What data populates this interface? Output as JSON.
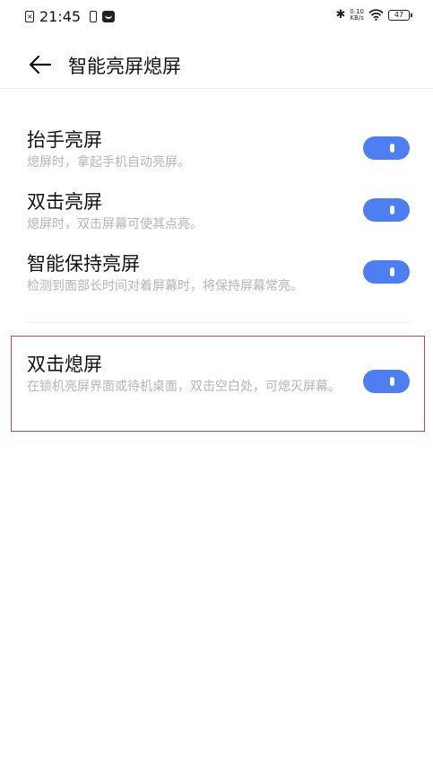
{
  "status_bar": {
    "time": "21:45",
    "net_speed_value": "0.10",
    "net_speed_unit": "KB/s",
    "battery_level": "47"
  },
  "header": {
    "title": "智能亮屏熄屏"
  },
  "settings": [
    {
      "title": "抬手亮屏",
      "description": "熄屏时，拿起手机自动亮屏。",
      "enabled": true
    },
    {
      "title": "双击亮屏",
      "description": "熄屏时，双击屏幕可使其点亮。",
      "enabled": true
    },
    {
      "title": "智能保持亮屏",
      "description": "检测到面部长时间对着屏幕时，将保持屏幕常亮。",
      "enabled": true
    },
    {
      "title": "双击熄屏",
      "description": "在锁机亮屏界面或待机桌面，双击空白处，可熄灭屏幕。",
      "enabled": true
    }
  ],
  "colors": {
    "toggle_on": "#4d7ff2",
    "highlight_border": "#c8453d",
    "description_text": "#b5b5b5"
  }
}
